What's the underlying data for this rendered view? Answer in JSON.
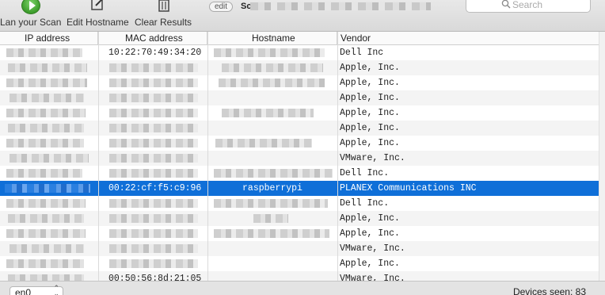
{
  "toolbar": {
    "scan_label": "Lan your Scan",
    "edit_label": "Edit Hostname",
    "clear_label": "Clear Results",
    "edit_pill": "edit",
    "scan_title_prefix": "Sc",
    "search_placeholder": "Search"
  },
  "table": {
    "columns": [
      "IP address",
      "MAC address",
      "Hostname",
      "Vendor"
    ],
    "rows": [
      {
        "mac": "10:22:70:49:34:20",
        "host": "",
        "vendor": "Dell Inc"
      },
      {
        "mac": "",
        "host": "",
        "vendor": "Apple, Inc."
      },
      {
        "mac": "",
        "host": "",
        "vendor": "Apple, Inc."
      },
      {
        "mac": "",
        "host": "",
        "vendor": "Apple, Inc."
      },
      {
        "mac": "",
        "host": "",
        "vendor": "Apple, Inc."
      },
      {
        "mac": "",
        "host": "",
        "vendor": "Apple, Inc."
      },
      {
        "mac": "",
        "host": "",
        "vendor": "Apple, Inc."
      },
      {
        "mac": "",
        "host": "",
        "vendor": "VMware, Inc."
      },
      {
        "mac": "",
        "host": "",
        "vendor": "Dell Inc."
      },
      {
        "mac": "00:22:cf:f5:c9:96",
        "host": "raspberrypi",
        "vendor": "PLANEX Communications INC",
        "selected": true
      },
      {
        "mac": "",
        "host": "",
        "vendor": "Dell Inc."
      },
      {
        "mac": "",
        "host": "",
        "vendor": "Apple, Inc."
      },
      {
        "mac": "",
        "host": "",
        "vendor": "Apple, Inc."
      },
      {
        "mac": "",
        "host": "",
        "vendor": "VMware, Inc."
      },
      {
        "mac": "",
        "host": "",
        "vendor": "Apple, Inc."
      },
      {
        "mac": "00:50:56:8d:21:05",
        "host": "",
        "vendor": "VMware, Inc."
      }
    ]
  },
  "bottom": {
    "interface": "en0",
    "devices_seen": "Devices seen: 83"
  },
  "colors": {
    "selection": "#0f6fd8",
    "play_green": "#3c9c2b"
  },
  "icons": [
    "play-icon",
    "edit-icon",
    "trash-icon",
    "search-icon",
    "updown-arrows-icon"
  ]
}
